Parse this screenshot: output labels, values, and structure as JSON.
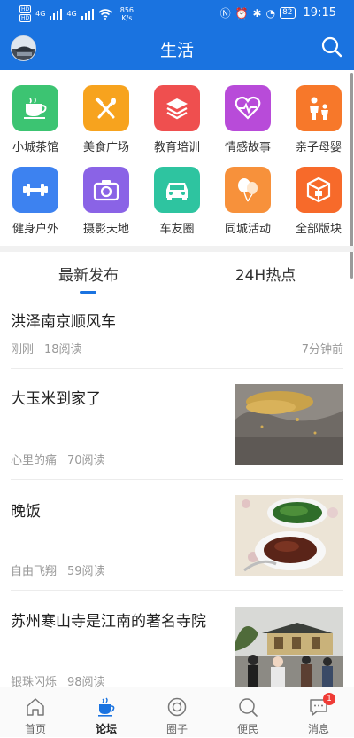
{
  "status_bar": {
    "sim1": "HD",
    "sim2": "HD",
    "net1": "4G",
    "net2": "4G",
    "speed_value": "856",
    "speed_unit": "K/s",
    "battery": "82",
    "time": "19:15"
  },
  "header": {
    "title": "生活"
  },
  "categories": [
    {
      "label": "小城茶馆",
      "color": "#3cc472",
      "icon": "teacup-icon"
    },
    {
      "label": "美食广场",
      "color": "#f7a31e",
      "icon": "fork-knife-icon"
    },
    {
      "label": "教育培训",
      "color": "#ef4f4f",
      "icon": "layers-icon"
    },
    {
      "label": "情感故事",
      "color": "#b84bd9",
      "icon": "heart-pulse-icon"
    },
    {
      "label": "亲子母婴",
      "color": "#f7782a",
      "icon": "parent-child-icon"
    },
    {
      "label": "健身户外",
      "color": "#3d82f0",
      "icon": "dumbbell-icon"
    },
    {
      "label": "摄影天地",
      "color": "#8a63e6",
      "icon": "camera-icon"
    },
    {
      "label": "车友圈",
      "color": "#2ec4a0",
      "icon": "car-icon"
    },
    {
      "label": "同城活动",
      "color": "#f7913b",
      "icon": "balloons-icon"
    },
    {
      "label": "全部版块",
      "color": "#f76a2a",
      "icon": "cube-icon"
    }
  ],
  "tabs": {
    "latest": "最新发布",
    "hot": "24H热点"
  },
  "feed": [
    {
      "title": "洪泽南京顺风车",
      "author": "刚刚",
      "reads": "18阅读",
      "time": "7分钟前"
    },
    {
      "title": "大玉米到家了",
      "author": "心里的痛",
      "reads": "70阅读"
    },
    {
      "title": "晚饭",
      "author": "自由飞翔",
      "reads": "59阅读"
    },
    {
      "title": "苏州寒山寺是江南的著名寺院",
      "author": "银珠闪烁",
      "reads": "98阅读"
    }
  ],
  "tabbar": {
    "home": "首页",
    "forum": "论坛",
    "circle": "圈子",
    "service": "便民",
    "messages": "消息",
    "messages_badge": "1"
  },
  "colors": {
    "brand": "#1a73e0",
    "badge": "#ef3b36"
  }
}
